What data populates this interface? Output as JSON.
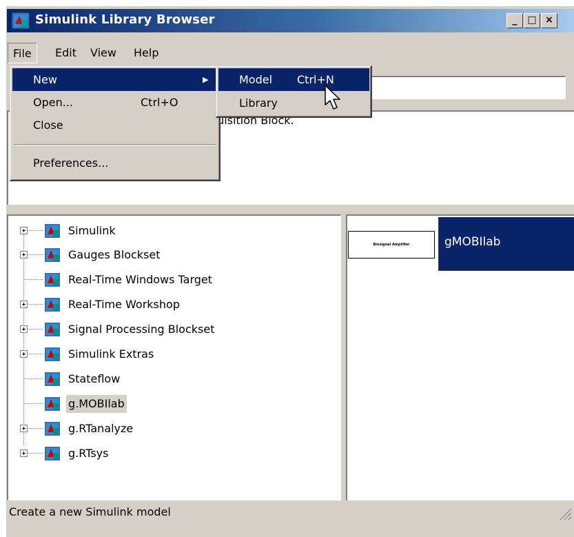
{
  "window": {
    "title": "Simulink Library Browser",
    "controls": {
      "minimize": "_",
      "maximize": "□",
      "close": "×"
    }
  },
  "menubar": {
    "items": [
      {
        "label": "File"
      },
      {
        "label": "Edit"
      },
      {
        "label": "View"
      },
      {
        "label": "Help"
      }
    ]
  },
  "file_menu": {
    "items": [
      {
        "label": "New",
        "shortcut": "",
        "submenu_arrow": "▶"
      },
      {
        "label": "Open...",
        "shortcut": "Ctrl+O"
      },
      {
        "label": "Close",
        "shortcut": ""
      },
      {
        "label": "Preferences...",
        "shortcut": ""
      }
    ]
  },
  "new_submenu": {
    "items": [
      {
        "label": "Model",
        "shortcut": "Ctrl+N"
      },
      {
        "label": "Library",
        "shortcut": ""
      }
    ]
  },
  "description": {
    "text": "quisition Block."
  },
  "tree": {
    "items": [
      {
        "label": "Simulink",
        "expandable": true
      },
      {
        "label": "Gauges Blockset",
        "expandable": true
      },
      {
        "label": "Real-Time Windows Target",
        "expandable": false
      },
      {
        "label": "Real-Time Workshop",
        "expandable": true
      },
      {
        "label": "Signal Processing Blockset",
        "expandable": true
      },
      {
        "label": "Simulink Extras",
        "expandable": true
      },
      {
        "label": "Stateflow",
        "expandable": false
      },
      {
        "label": "g.MOBIlab",
        "expandable": false,
        "selected": true
      },
      {
        "label": "g.RTanalyze",
        "expandable": true
      },
      {
        "label": "g.RTsys",
        "expandable": true
      }
    ]
  },
  "blocks": {
    "sample_label": "Biosignal Amplifier",
    "selected_block": "gMOBIlab"
  },
  "status": {
    "text": "Create a new Simulink model"
  },
  "colors": {
    "highlight": "#0a246a",
    "face": "#d4d0c8",
    "title_gradient_start": "#0a246a",
    "title_gradient_end": "#a6caf0"
  },
  "icons": {
    "library": "simulink-library-icon",
    "pointer": "mouse-pointer-icon"
  }
}
